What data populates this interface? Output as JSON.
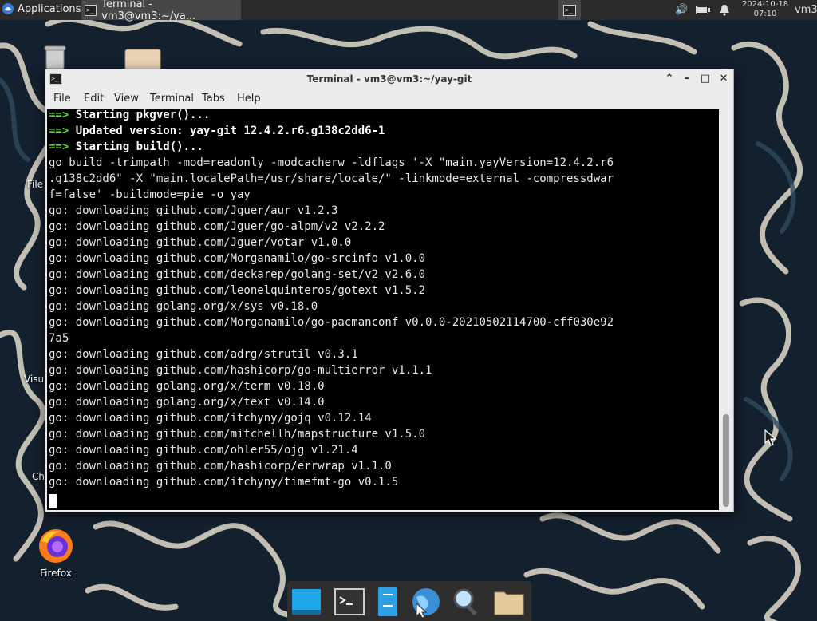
{
  "top_panel": {
    "applications_label": "Applications",
    "task_title": "Terminal - vm3@vm3:~/ya...",
    "clock_date": "2024-10-18",
    "clock_time": "07:10",
    "user": "vm3"
  },
  "desktop": {
    "icons": [
      {
        "label": "File"
      },
      {
        "label": "Visu"
      },
      {
        "label": "Ch"
      },
      {
        "label": "Firefox"
      }
    ]
  },
  "window": {
    "title": "Terminal - vm3@vm3:~/yay-git",
    "menu": [
      "File",
      "Edit",
      "View",
      "Terminal",
      "Tabs",
      "Help"
    ]
  },
  "terminal": {
    "lines": [
      {
        "prefix": "==> ",
        "text": "Starting pkgver()...",
        "bold": true
      },
      {
        "prefix": "==> ",
        "text": "Updated version: yay-git 12.4.2.r6.g138c2dd6-1",
        "bold": true
      },
      {
        "prefix": "==> ",
        "text": "Starting build()...",
        "bold": true
      },
      {
        "prefix": "",
        "text": "go build -trimpath -mod=readonly -modcacherw -ldflags '-X \"main.yayVersion=12.4.2.r6",
        "bold": false
      },
      {
        "prefix": "",
        "text": ".g138c2dd6\" -X \"main.localePath=/usr/share/locale/\" -linkmode=external -compressdwar",
        "bold": false
      },
      {
        "prefix": "",
        "text": "f=false' -buildmode=pie -o yay",
        "bold": false
      },
      {
        "prefix": "",
        "text": "go: downloading github.com/Jguer/aur v1.2.3",
        "bold": false
      },
      {
        "prefix": "",
        "text": "go: downloading github.com/Jguer/go-alpm/v2 v2.2.2",
        "bold": false
      },
      {
        "prefix": "",
        "text": "go: downloading github.com/Jguer/votar v1.0.0",
        "bold": false
      },
      {
        "prefix": "",
        "text": "go: downloading github.com/Morganamilo/go-srcinfo v1.0.0",
        "bold": false
      },
      {
        "prefix": "",
        "text": "go: downloading github.com/deckarep/golang-set/v2 v2.6.0",
        "bold": false
      },
      {
        "prefix": "",
        "text": "go: downloading github.com/leonelquinteros/gotext v1.5.2",
        "bold": false
      },
      {
        "prefix": "",
        "text": "go: downloading golang.org/x/sys v0.18.0",
        "bold": false
      },
      {
        "prefix": "",
        "text": "go: downloading github.com/Morganamilo/go-pacmanconf v0.0.0-20210502114700-cff030e92",
        "bold": false
      },
      {
        "prefix": "",
        "text": "7a5",
        "bold": false
      },
      {
        "prefix": "",
        "text": "go: downloading github.com/adrg/strutil v0.3.1",
        "bold": false
      },
      {
        "prefix": "",
        "text": "go: downloading github.com/hashicorp/go-multierror v1.1.1",
        "bold": false
      },
      {
        "prefix": "",
        "text": "go: downloading golang.org/x/term v0.18.0",
        "bold": false
      },
      {
        "prefix": "",
        "text": "go: downloading golang.org/x/text v0.14.0",
        "bold": false
      },
      {
        "prefix": "",
        "text": "go: downloading github.com/itchyny/gojq v0.12.14",
        "bold": false
      },
      {
        "prefix": "",
        "text": "go: downloading github.com/mitchellh/mapstructure v1.5.0",
        "bold": false
      },
      {
        "prefix": "",
        "text": "go: downloading github.com/ohler55/ojg v1.21.4",
        "bold": false
      },
      {
        "prefix": "",
        "text": "go: downloading github.com/hashicorp/errwrap v1.1.0",
        "bold": false
      },
      {
        "prefix": "",
        "text": "go: downloading github.com/itchyny/timefmt-go v0.1.5",
        "bold": false
      }
    ]
  },
  "icons": {
    "apps": "xfce-menu-icon",
    "volume": "volume-icon",
    "battery": "battery-icon",
    "notify": "bell-icon"
  },
  "colors": {
    "arrow_green": "#5bd13c",
    "panel": "#2b2b2b",
    "terminal_bg": "#000000"
  }
}
